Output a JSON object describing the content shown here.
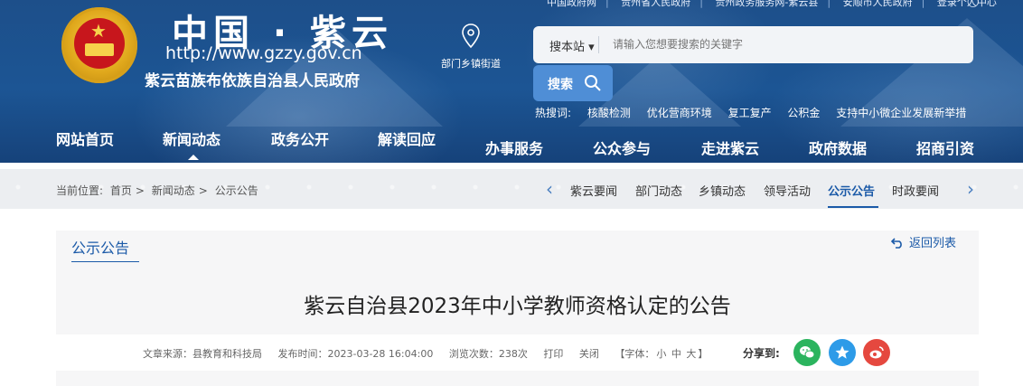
{
  "topbar": {
    "links": [
      "中国政府网",
      "贵州省人民政府",
      "贵州政务服务网-紫云县",
      "安顺市人民政府",
      "登录个人中心"
    ]
  },
  "header": {
    "title": "中国 · 紫云",
    "url": "http://www.gzzy.gov.cn",
    "org": "紫云苗族布依族自治县人民政府",
    "dept_label": "部门乡镇街道"
  },
  "search": {
    "site_select": "搜本站",
    "placeholder": "请输入您想要搜索的关键字",
    "button": "搜索",
    "hot_label": "热搜词:",
    "hot_terms": [
      "核酸检测",
      "优化营商环境",
      "复工复产",
      "公积金",
      "支持中小微企业发展新举措"
    ]
  },
  "nav": {
    "items": [
      "网站首页",
      "新闻动态",
      "政务公开",
      "解读回应",
      "办事服务",
      "公众参与",
      "走进紫云",
      "政府数据",
      "招商引资"
    ],
    "active": "新闻动态"
  },
  "breadcrumb": {
    "label": "当前位置:",
    "items": [
      "首页",
      "新闻动态",
      "公示公告"
    ]
  },
  "subnav": {
    "items": [
      "紫云要闻",
      "部门动态",
      "乡镇动态",
      "领导活动",
      "公示公告",
      "时政要闻"
    ],
    "active": "公示公告"
  },
  "article": {
    "section": "公示公告",
    "back": "返回列表",
    "title": "紫云自治县2023年中小学教师资格认定的公告",
    "source": "文章来源：县教育和科技局",
    "time": "发布时间：2023-03-28 16:04:00",
    "views": "浏览次数：238次",
    "print": "打印",
    "close": "关闭",
    "font_open": "【字体：",
    "font_small": "小",
    "font_medium": "中",
    "font_large": "大",
    "font_close": "】",
    "share_label": "分享到:"
  },
  "colors": {
    "banner": "#1c5594",
    "accent": "#1b5aa8",
    "search_button": "#4f8ed6",
    "wechat": "#2bb45e",
    "qzone": "#2d9be8",
    "weibo": "#e5483f"
  }
}
